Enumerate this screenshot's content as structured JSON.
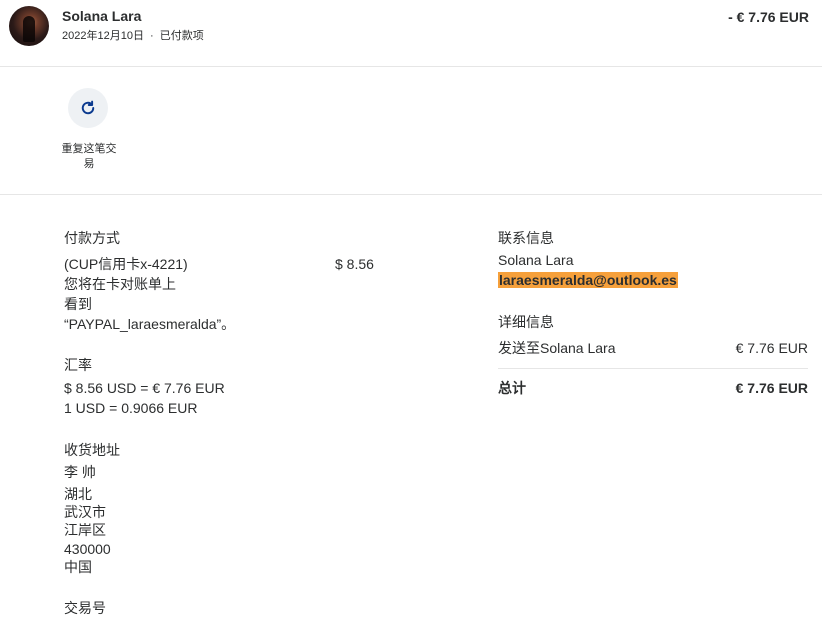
{
  "header": {
    "name": "Solana Lara",
    "date": "2022年12月10日",
    "separator": "·",
    "status": "已付款项",
    "amount": "- € 7.76 EUR"
  },
  "actions": {
    "repeat_label": "重复这笔交易",
    "repeat_icon": "refresh-icon"
  },
  "payment": {
    "title": "付款方式",
    "method": "(CUP信用卡x-4221)",
    "amount": "$ 8.56",
    "note_line1": "您将在卡对账单上",
    "note_line2": "看到",
    "note_line3": "“PAYPAL_laraesmeralda”。"
  },
  "exchange": {
    "title": "汇率",
    "line1": "$ 8.56 USD = € 7.76 EUR",
    "line2": "1 USD = 0.9066 EUR"
  },
  "shipping": {
    "title": "收货地址",
    "name": "李 帅",
    "province": "湖北",
    "city": "武汉市",
    "district": "江岸区",
    "postcode": "430000",
    "country": "中国"
  },
  "transaction": {
    "title": "交易号"
  },
  "contact": {
    "title": "联系信息",
    "name": "Solana Lara",
    "email": "laraesmeralda@outlook.es"
  },
  "details": {
    "title": "详细信息",
    "sent_label": "发送至Solana Lara",
    "sent_amount": "€ 7.76 EUR",
    "total_label": "总计",
    "total_amount": "€ 7.76 EUR"
  },
  "colors": {
    "highlight": "#f6a03b",
    "icon_blue": "#0b3a8f"
  }
}
